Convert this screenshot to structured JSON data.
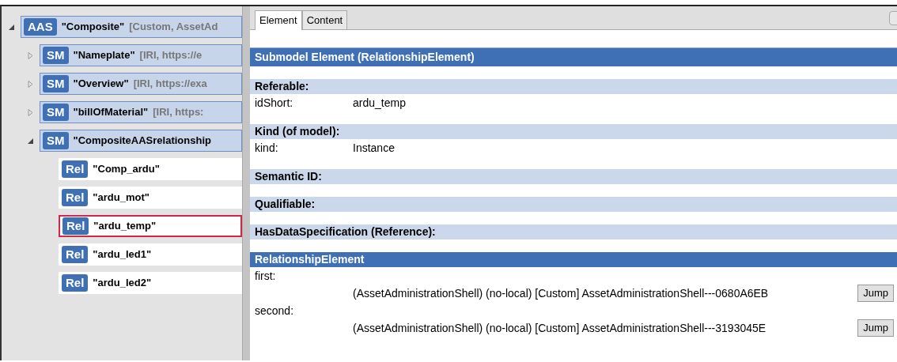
{
  "tree": [
    {
      "badge": "AAS",
      "name": "\"Composite\"",
      "info": "[Custom, AssetAd",
      "expanded": true,
      "selected": false,
      "children": [
        {
          "badge": "SM",
          "name": "\"Nameplate\"",
          "info": "[IRI, https://e",
          "expanded": false,
          "selected": false
        },
        {
          "badge": "SM",
          "name": "\"Overview\"",
          "info": "[IRI, https://exa",
          "expanded": false,
          "selected": false
        },
        {
          "badge": "SM",
          "name": "\"billOfMaterial\"",
          "info": "[IRI, https:",
          "expanded": false,
          "selected": false
        },
        {
          "badge": "SM",
          "name": "\"CompositeAASrelationship",
          "expanded": true,
          "selected": false,
          "children": [
            {
              "badge": "Rel",
              "name": "\"Comp_ardu\"",
              "selected": false
            },
            {
              "badge": "Rel",
              "name": "\"ardu_mot\"",
              "selected": false
            },
            {
              "badge": "Rel",
              "name": "\"ardu_temp\"",
              "selected": true
            },
            {
              "badge": "Rel",
              "name": "\"ardu_led1\"",
              "selected": false
            },
            {
              "badge": "Rel",
              "name": "\"ardu_led2\"",
              "selected": false
            }
          ]
        }
      ]
    }
  ],
  "tabs": [
    {
      "label": "Element",
      "selected": true
    },
    {
      "label": "Content",
      "selected": false
    }
  ],
  "header": "Submodel Element (RelationshipElement)",
  "sections": [
    {
      "title": "Referable:",
      "fields": [
        {
          "kind": "text",
          "label": "idShort:",
          "value": "ardu_temp"
        }
      ]
    },
    {
      "title": "Kind (of model):",
      "fields": [
        {
          "kind": "text",
          "label": "kind:",
          "value": "Instance"
        }
      ]
    },
    {
      "title": "Semantic ID:"
    },
    {
      "title": "Qualifiable:"
    },
    {
      "title": "HasDataSpecification (Reference):"
    },
    {
      "title": "RelationshipElement",
      "strong": true,
      "fields": [
        {
          "kind": "reference",
          "label": "first:",
          "value": "(AssetAdministrationShell) (no-local) [Custom] AssetAdministrationShell---0680A6EB",
          "button": "Jump"
        },
        {
          "kind": "reference",
          "label": "second:",
          "value": "(AssetAdministrationShell) (no-local) [Custom] AssetAdministrationShell---3193045E",
          "button": "Jump"
        }
      ]
    }
  ]
}
